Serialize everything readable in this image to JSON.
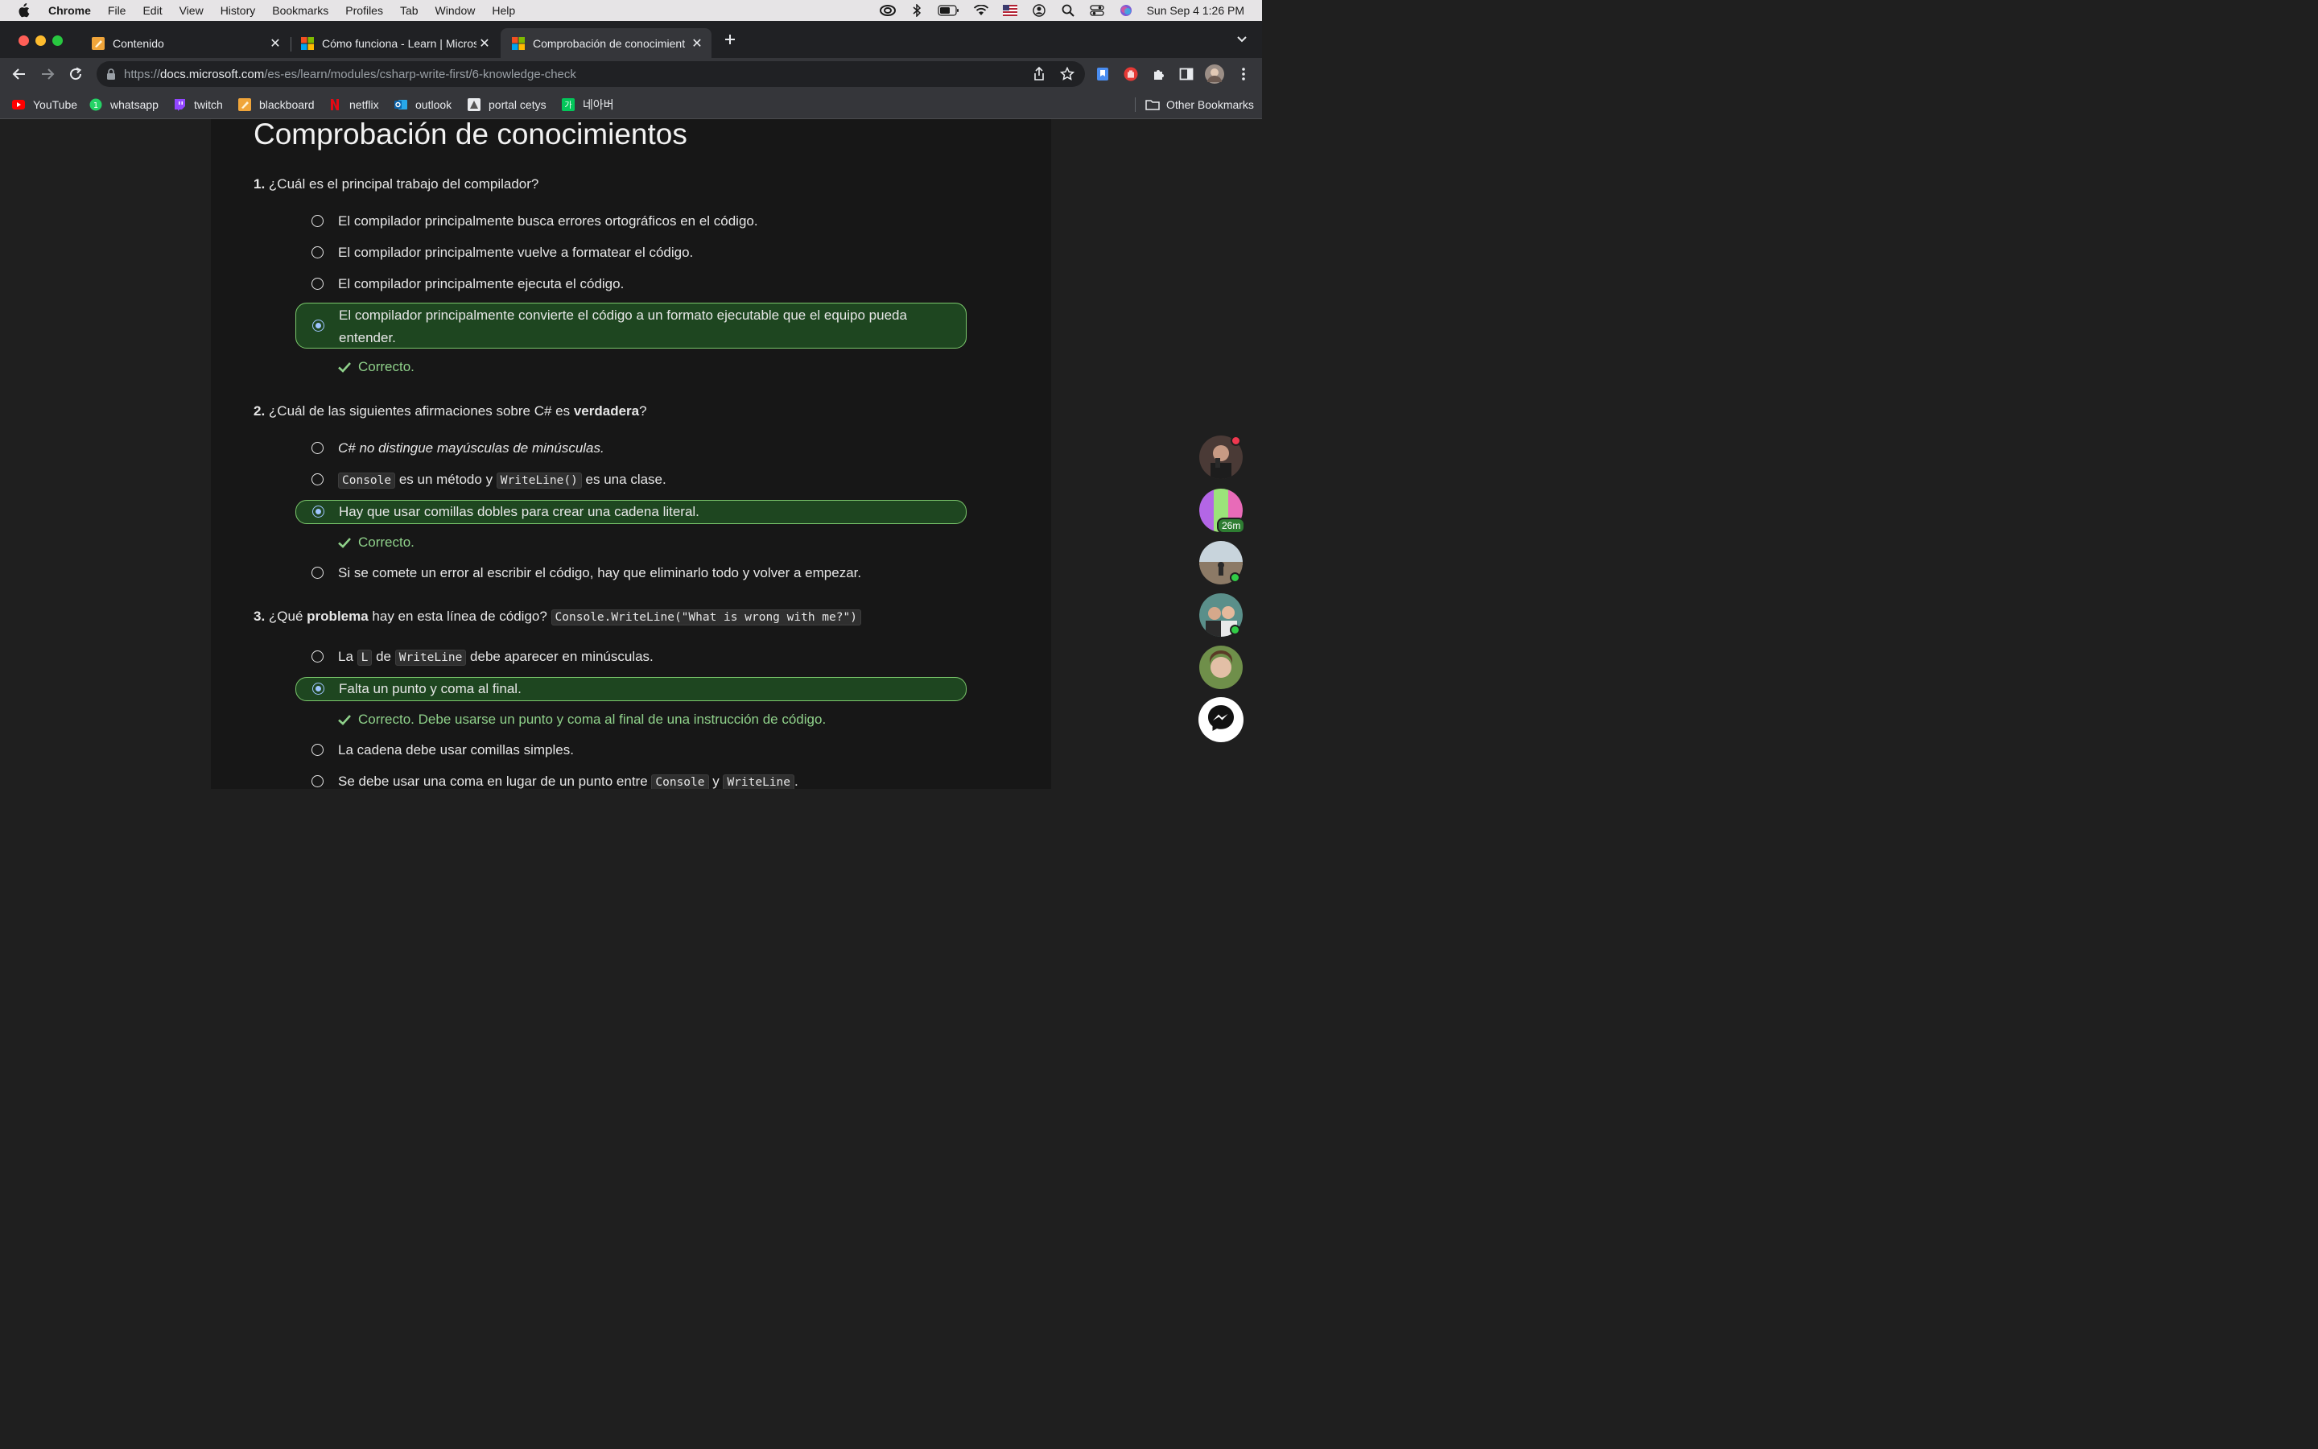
{
  "menubar": {
    "app": "Chrome",
    "items": [
      "File",
      "Edit",
      "View",
      "History",
      "Bookmarks",
      "Profiles",
      "Tab",
      "Window",
      "Help"
    ],
    "clock": "Sun Sep 4  1:26 PM"
  },
  "tabs": [
    {
      "title": "Contenido"
    },
    {
      "title": "Cómo funciona - Learn | Micros"
    },
    {
      "title": "Comprobación de conocimient"
    }
  ],
  "address": {
    "scheme": "https://",
    "host": "docs.microsoft.com",
    "path": "/es-es/learn/modules/csharp-write-first/6-knowledge-check"
  },
  "bookmarks": [
    {
      "label": "YouTube"
    },
    {
      "label": "whatsapp"
    },
    {
      "label": "twitch"
    },
    {
      "label": "blackboard"
    },
    {
      "label": "netflix"
    },
    {
      "label": "outlook"
    },
    {
      "label": "portal cetys"
    },
    {
      "label": "네아버"
    }
  ],
  "other_bookmarks": "Other Bookmarks",
  "page": {
    "title": "Comprobación de conocimientos",
    "q1": {
      "num": "1.",
      "text": "¿Cuál es el principal trabajo del compilador?",
      "options": [
        "El compilador principalmente busca errores ortográficos en el código.",
        "El compilador principalmente vuelve a formatear el código.",
        "El compilador principalmente ejecuta el código.",
        "El compilador principalmente convierte el código a un formato ejecutable que el equipo pueda entender."
      ],
      "feedback": "Correcto."
    },
    "q2": {
      "num": "2.",
      "pre": "¿Cuál de las siguientes afirmaciones sobre C# es ",
      "bold": "verdadera",
      "post": "?",
      "opt1": "C# no distingue mayúsculas de minúsculas.",
      "opt2_code1": "Console",
      "opt2_mid": " es un método y ",
      "opt2_code2": "WriteLine()",
      "opt2_end": " es una clase.",
      "opt3": "Hay que usar comillas dobles para crear una cadena literal.",
      "feedback": "Correcto.",
      "opt4": "Si se comete un error al escribir el código, hay que eliminarlo todo y volver a empezar."
    },
    "q3": {
      "num": "3.",
      "pre": "¿Qué ",
      "bold": "problema",
      "mid": " hay en esta línea de código? ",
      "code": "Console.WriteLine(\"What is wrong with me?\")",
      "opt1_a": "La ",
      "opt1_code1": "L",
      "opt1_b": " de ",
      "opt1_code2": "WriteLine",
      "opt1_c": " debe aparecer en minúsculas.",
      "opt2": "Falta un punto y coma al final.",
      "feedback": "Correcto. Debe usarse un punto y coma al final de una instrucción de código.",
      "opt3": "La cadena debe usar comillas simples.",
      "opt4_a": "Se debe usar una coma en lugar de un punto entre ",
      "opt4_code1": "Console",
      "opt4_b": " y ",
      "opt4_code2": "WriteLine",
      "opt4_c": "."
    }
  },
  "chat": {
    "time_badge": "26m"
  },
  "colors": {
    "correct_bg": "#1e4620",
    "correct_border": "#7bc86c",
    "feedback_text": "#8fd18a"
  }
}
